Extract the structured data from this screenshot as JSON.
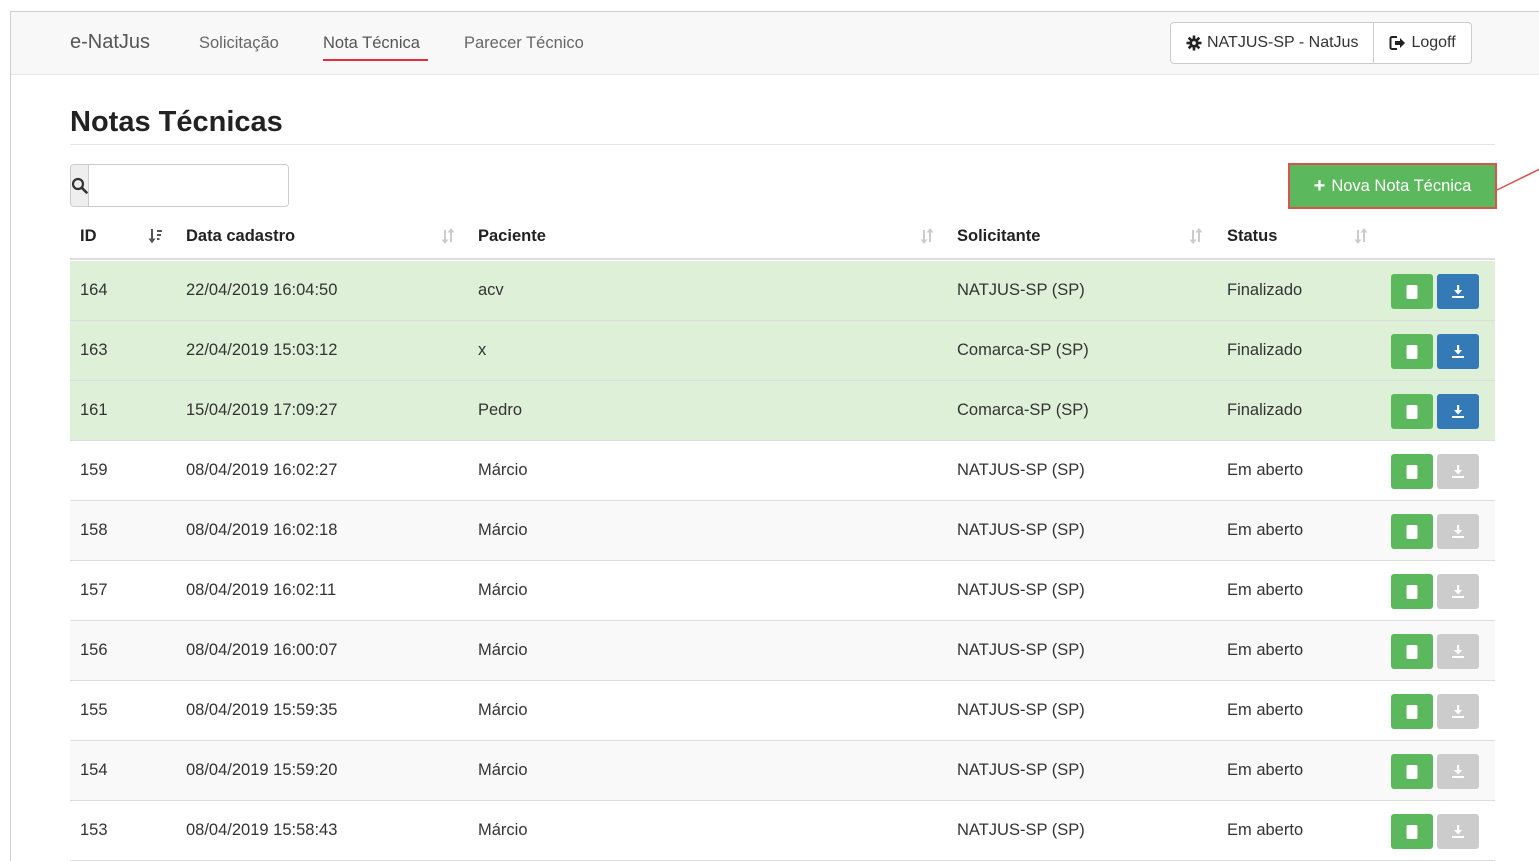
{
  "navbar": {
    "brand": "e-NatJus",
    "links": [
      "Solicitação",
      "Nota Técnica",
      "Parecer Técnico"
    ],
    "active": "Nota Técnica",
    "user_button": "NATJUS-SP - NatJus",
    "logoff_button": "Logoff"
  },
  "page": {
    "title": "Notas Técnicas",
    "search_value": "",
    "new_button": "Nova Nota Técnica"
  },
  "table": {
    "columns": [
      "ID",
      "Data cadastro",
      "Paciente",
      "Solicitante",
      "Status"
    ],
    "sorted_column": "ID",
    "rows": [
      {
        "id": "164",
        "date": "22/04/2019 16:04:50",
        "patient": "acv",
        "requester": "NATJUS-SP (SP)",
        "status": "Finalizado"
      },
      {
        "id": "163",
        "date": "22/04/2019 15:03:12",
        "patient": "x",
        "requester": "Comarca-SP (SP)",
        "status": "Finalizado"
      },
      {
        "id": "161",
        "date": "15/04/2019 17:09:27",
        "patient": "Pedro",
        "requester": "Comarca-SP (SP)",
        "status": "Finalizado"
      },
      {
        "id": "159",
        "date": "08/04/2019 16:02:27",
        "patient": "Márcio",
        "requester": "NATJUS-SP (SP)",
        "status": "Em aberto"
      },
      {
        "id": "158",
        "date": "08/04/2019 16:02:18",
        "patient": "Márcio",
        "requester": "NATJUS-SP (SP)",
        "status": "Em aberto"
      },
      {
        "id": "157",
        "date": "08/04/2019 16:02:11",
        "patient": "Márcio",
        "requester": "NATJUS-SP (SP)",
        "status": "Em aberto"
      },
      {
        "id": "156",
        "date": "08/04/2019 16:00:07",
        "patient": "Márcio",
        "requester": "NATJUS-SP (SP)",
        "status": "Em aberto"
      },
      {
        "id": "155",
        "date": "08/04/2019 15:59:35",
        "patient": "Márcio",
        "requester": "NATJUS-SP (SP)",
        "status": "Em aberto"
      },
      {
        "id": "154",
        "date": "08/04/2019 15:59:20",
        "patient": "Márcio",
        "requester": "NATJUS-SP (SP)",
        "status": "Em aberto"
      },
      {
        "id": "153",
        "date": "08/04/2019 15:58:43",
        "patient": "Márcio",
        "requester": "NATJUS-SP (SP)",
        "status": "Em aberto"
      }
    ]
  },
  "icons": {
    "user_button": "gear-icon",
    "logoff_button": "sign-out-icon",
    "search": "search-icon",
    "new_button": "plus-icon",
    "row_view": "document-icon",
    "row_download": "download-icon"
  },
  "colors": {
    "active_underline": "#e0303a",
    "success": "#5cb85c",
    "primary": "#337ab7",
    "disabled": "#cccccc",
    "finalized_row": "#dff0d8",
    "highlight_border": "#d9534f"
  }
}
